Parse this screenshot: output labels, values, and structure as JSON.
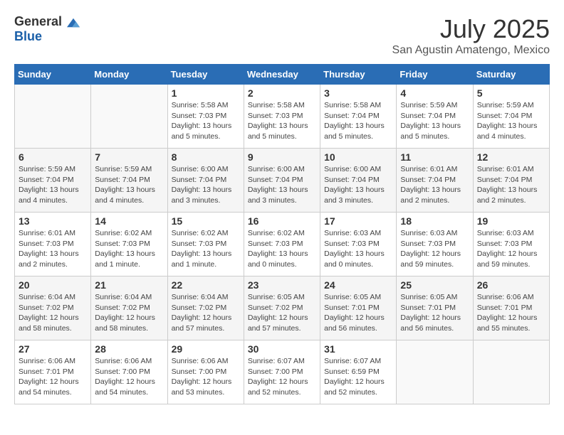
{
  "logo": {
    "general": "General",
    "blue": "Blue"
  },
  "title": "July 2025",
  "location": "San Agustin Amatengo, Mexico",
  "days_of_week": [
    "Sunday",
    "Monday",
    "Tuesday",
    "Wednesday",
    "Thursday",
    "Friday",
    "Saturday"
  ],
  "weeks": [
    [
      {
        "day": "",
        "detail": ""
      },
      {
        "day": "",
        "detail": ""
      },
      {
        "day": "1",
        "detail": "Sunrise: 5:58 AM\nSunset: 7:03 PM\nDaylight: 13 hours\nand 5 minutes."
      },
      {
        "day": "2",
        "detail": "Sunrise: 5:58 AM\nSunset: 7:03 PM\nDaylight: 13 hours\nand 5 minutes."
      },
      {
        "day": "3",
        "detail": "Sunrise: 5:58 AM\nSunset: 7:04 PM\nDaylight: 13 hours\nand 5 minutes."
      },
      {
        "day": "4",
        "detail": "Sunrise: 5:59 AM\nSunset: 7:04 PM\nDaylight: 13 hours\nand 5 minutes."
      },
      {
        "day": "5",
        "detail": "Sunrise: 5:59 AM\nSunset: 7:04 PM\nDaylight: 13 hours\nand 4 minutes."
      }
    ],
    [
      {
        "day": "6",
        "detail": "Sunrise: 5:59 AM\nSunset: 7:04 PM\nDaylight: 13 hours\nand 4 minutes."
      },
      {
        "day": "7",
        "detail": "Sunrise: 5:59 AM\nSunset: 7:04 PM\nDaylight: 13 hours\nand 4 minutes."
      },
      {
        "day": "8",
        "detail": "Sunrise: 6:00 AM\nSunset: 7:04 PM\nDaylight: 13 hours\nand 3 minutes."
      },
      {
        "day": "9",
        "detail": "Sunrise: 6:00 AM\nSunset: 7:04 PM\nDaylight: 13 hours\nand 3 minutes."
      },
      {
        "day": "10",
        "detail": "Sunrise: 6:00 AM\nSunset: 7:04 PM\nDaylight: 13 hours\nand 3 minutes."
      },
      {
        "day": "11",
        "detail": "Sunrise: 6:01 AM\nSunset: 7:04 PM\nDaylight: 13 hours\nand 2 minutes."
      },
      {
        "day": "12",
        "detail": "Sunrise: 6:01 AM\nSunset: 7:04 PM\nDaylight: 13 hours\nand 2 minutes."
      }
    ],
    [
      {
        "day": "13",
        "detail": "Sunrise: 6:01 AM\nSunset: 7:03 PM\nDaylight: 13 hours\nand 2 minutes."
      },
      {
        "day": "14",
        "detail": "Sunrise: 6:02 AM\nSunset: 7:03 PM\nDaylight: 13 hours\nand 1 minute."
      },
      {
        "day": "15",
        "detail": "Sunrise: 6:02 AM\nSunset: 7:03 PM\nDaylight: 13 hours\nand 1 minute."
      },
      {
        "day": "16",
        "detail": "Sunrise: 6:02 AM\nSunset: 7:03 PM\nDaylight: 13 hours\nand 0 minutes."
      },
      {
        "day": "17",
        "detail": "Sunrise: 6:03 AM\nSunset: 7:03 PM\nDaylight: 13 hours\nand 0 minutes."
      },
      {
        "day": "18",
        "detail": "Sunrise: 6:03 AM\nSunset: 7:03 PM\nDaylight: 12 hours\nand 59 minutes."
      },
      {
        "day": "19",
        "detail": "Sunrise: 6:03 AM\nSunset: 7:03 PM\nDaylight: 12 hours\nand 59 minutes."
      }
    ],
    [
      {
        "day": "20",
        "detail": "Sunrise: 6:04 AM\nSunset: 7:02 PM\nDaylight: 12 hours\nand 58 minutes."
      },
      {
        "day": "21",
        "detail": "Sunrise: 6:04 AM\nSunset: 7:02 PM\nDaylight: 12 hours\nand 58 minutes."
      },
      {
        "day": "22",
        "detail": "Sunrise: 6:04 AM\nSunset: 7:02 PM\nDaylight: 12 hours\nand 57 minutes."
      },
      {
        "day": "23",
        "detail": "Sunrise: 6:05 AM\nSunset: 7:02 PM\nDaylight: 12 hours\nand 57 minutes."
      },
      {
        "day": "24",
        "detail": "Sunrise: 6:05 AM\nSunset: 7:01 PM\nDaylight: 12 hours\nand 56 minutes."
      },
      {
        "day": "25",
        "detail": "Sunrise: 6:05 AM\nSunset: 7:01 PM\nDaylight: 12 hours\nand 56 minutes."
      },
      {
        "day": "26",
        "detail": "Sunrise: 6:06 AM\nSunset: 7:01 PM\nDaylight: 12 hours\nand 55 minutes."
      }
    ],
    [
      {
        "day": "27",
        "detail": "Sunrise: 6:06 AM\nSunset: 7:01 PM\nDaylight: 12 hours\nand 54 minutes."
      },
      {
        "day": "28",
        "detail": "Sunrise: 6:06 AM\nSunset: 7:00 PM\nDaylight: 12 hours\nand 54 minutes."
      },
      {
        "day": "29",
        "detail": "Sunrise: 6:06 AM\nSunset: 7:00 PM\nDaylight: 12 hours\nand 53 minutes."
      },
      {
        "day": "30",
        "detail": "Sunrise: 6:07 AM\nSunset: 7:00 PM\nDaylight: 12 hours\nand 52 minutes."
      },
      {
        "day": "31",
        "detail": "Sunrise: 6:07 AM\nSunset: 6:59 PM\nDaylight: 12 hours\nand 52 minutes."
      },
      {
        "day": "",
        "detail": ""
      },
      {
        "day": "",
        "detail": ""
      }
    ]
  ]
}
